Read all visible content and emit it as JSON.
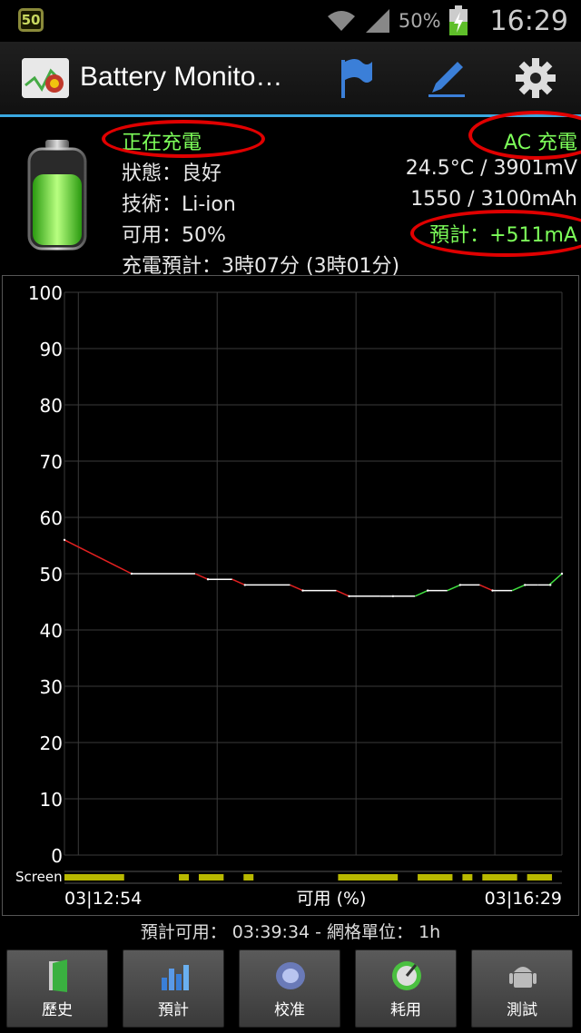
{
  "status_bar": {
    "notification_badge": "50",
    "battery_percent": "50%",
    "time": "16:29"
  },
  "action_bar": {
    "title": "Battery Monito…",
    "icons": [
      "flag-icon",
      "pencil-icon",
      "gear-icon"
    ]
  },
  "info": {
    "charging_state": "正在充電",
    "power_source": "AC 充電",
    "status": "狀態：良好",
    "temp_voltage": "24.5°C / 3901mV",
    "technology": "技術：Li-ion",
    "capacity": "1550 / 3100mAh",
    "available": "可用：50%",
    "estimated_current": "預計：+511mA",
    "charge_estimate": "充電預計：3時07分 (3時01分)"
  },
  "colors": {
    "accent": "#3aa8e0",
    "green": "#7dff5a",
    "highlight_ellipse": "#e00000",
    "line_discharge": "#e02020",
    "line_flat": "#ffffff",
    "line_charge": "#40e040",
    "screen_bar": "#b8b800"
  },
  "chart_data": {
    "type": "line",
    "ylim": [
      0,
      100
    ],
    "yticks": [
      "100",
      "90",
      "80",
      "70",
      "60",
      "50",
      "40",
      "30",
      "20",
      "10",
      "0"
    ],
    "xlabel": "可用 (%)",
    "x_start_label": "03|12:54",
    "x_end_label": "03|16:29",
    "screen_label": "Screen",
    "grid": true,
    "series": [
      {
        "x": [
          "12:54",
          "13:23",
          "13:56",
          "14:12",
          "14:37",
          "14:57",
          "15:16",
          "15:31",
          "15:45",
          "15:59",
          "16:13",
          "16:24",
          "16:29"
        ],
        "values": [
          56,
          50,
          49,
          48,
          47,
          46,
          46,
          47,
          48,
          47,
          48,
          48,
          50
        ]
      }
    ],
    "screen_on_fraction": 0.55
  },
  "summary": "預計可用： 03:39:34 - 網格單位： 1h",
  "tabs": [
    {
      "label": "歷史",
      "icon": "history-icon"
    },
    {
      "label": "預計",
      "icon": "estimate-icon"
    },
    {
      "label": "校准",
      "icon": "calibrate-icon"
    },
    {
      "label": "耗用",
      "icon": "usage-icon"
    },
    {
      "label": "測試",
      "icon": "test-icon"
    }
  ]
}
